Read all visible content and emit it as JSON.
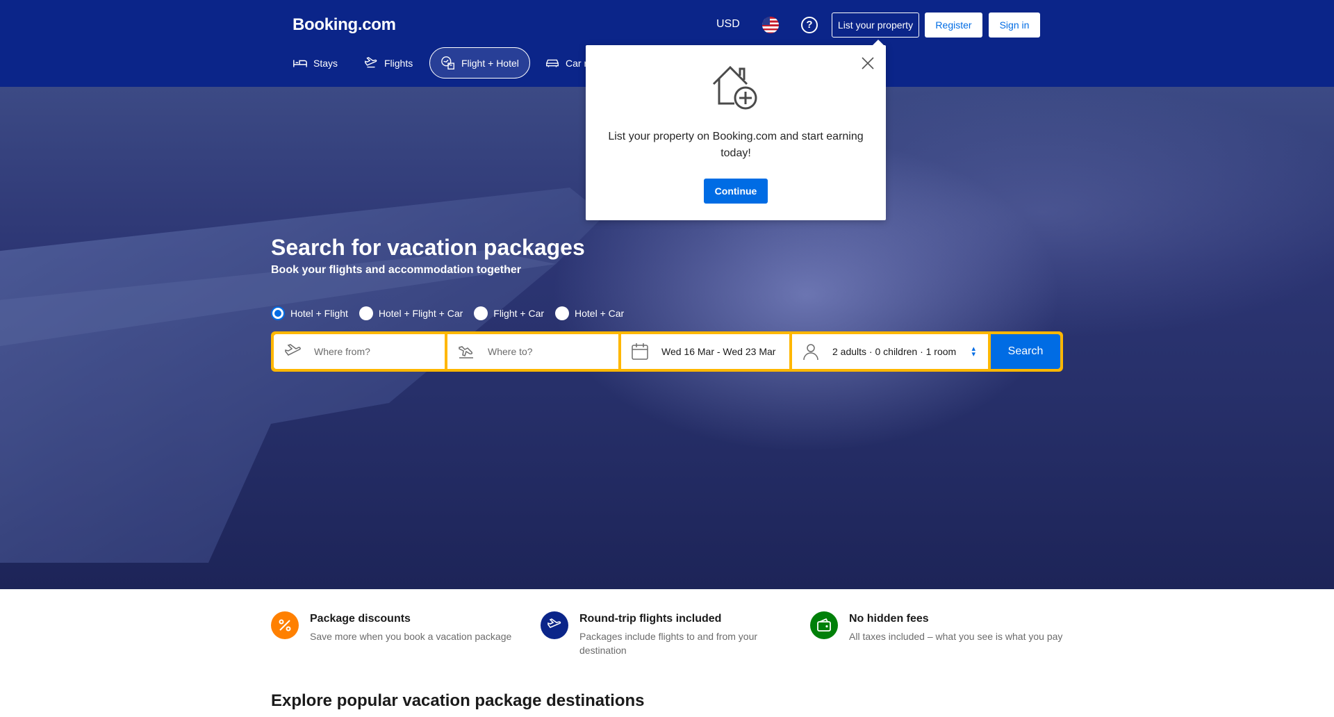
{
  "header": {
    "logo": "Booking.com",
    "currency": "USD",
    "list_property": "List your property",
    "register": "Register",
    "sign_in": "Sign in"
  },
  "nav": {
    "items": [
      {
        "label": "Stays",
        "icon": "bed-icon"
      },
      {
        "label": "Flights",
        "icon": "plane-icon"
      },
      {
        "label": "Flight + Hotel",
        "icon": "flight-hotel-icon",
        "active": true
      },
      {
        "label": "Car r",
        "icon": "car-icon"
      }
    ]
  },
  "popup": {
    "text": "List your property on Booking.com and start earning today!",
    "button": "Continue"
  },
  "hero": {
    "title": "Search for vacation packages",
    "subtitle": "Book your flights and accommodation together"
  },
  "package_types": [
    {
      "label": "Hotel + Flight",
      "selected": true
    },
    {
      "label": "Hotel + Flight + Car",
      "selected": false
    },
    {
      "label": "Flight + Car",
      "selected": false
    },
    {
      "label": "Hotel + Car",
      "selected": false
    }
  ],
  "search": {
    "from_placeholder": "Where from?",
    "to_placeholder": "Where to?",
    "dates": "Wed 16 Mar - Wed 23 Mar",
    "guests": "2 adults · 0 children · 1 room",
    "button": "Search"
  },
  "features": [
    {
      "title": "Package discounts",
      "desc": "Save more when you book a vacation package",
      "color": "#ff8000",
      "icon": "percent-icon"
    },
    {
      "title": "Round-trip flights included",
      "desc": "Packages include flights to and from your destination",
      "color": "#0b2589",
      "icon": "plane-icon"
    },
    {
      "title": "No hidden fees",
      "desc": "All taxes included – what you see is what you pay",
      "color": "#008009",
      "icon": "wallet-icon"
    }
  ],
  "explore_title": "Explore popular vacation package destinations",
  "colors": {
    "brand": "#0b2589",
    "accent": "#006ce4",
    "search_border": "#ffb700"
  }
}
